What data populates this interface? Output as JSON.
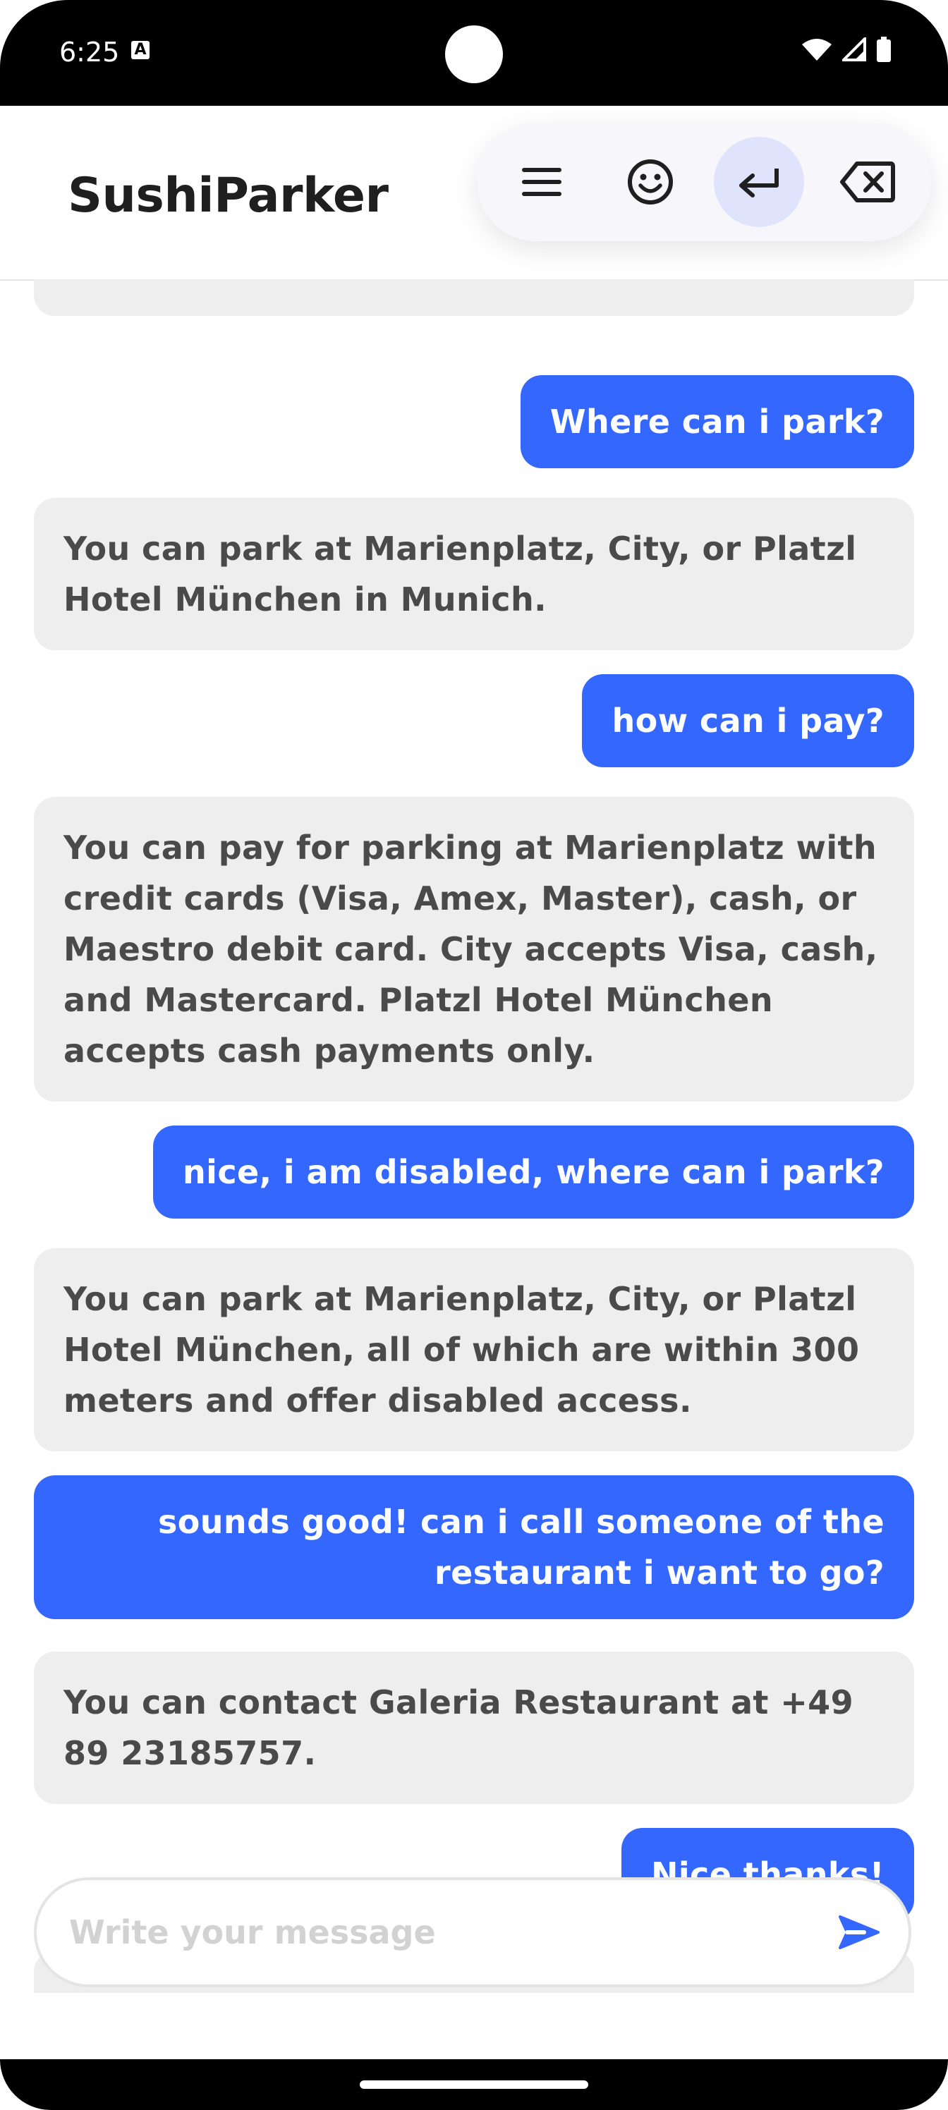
{
  "status_bar": {
    "time": "6:25",
    "notification_icon": "A",
    "icons": [
      "wifi-icon",
      "cellular-signal-icon",
      "battery-icon"
    ]
  },
  "app": {
    "title": "SushiParker"
  },
  "keyboard_toolbar": {
    "buttons": [
      "menu-icon",
      "emoji-icon",
      "enter-icon",
      "backspace-icon"
    ],
    "active": "enter-icon"
  },
  "colors": {
    "user_bubble": "#3467fe",
    "bot_bubble": "#eeeeee",
    "bot_text": "#4a4a4a",
    "active_key": "#dfe3fb"
  },
  "messages": [
    {
      "role": "user",
      "text": "Where can i park?"
    },
    {
      "role": "bot",
      "text": "You can park at Marienplatz, City, or Platzl Hotel München in Munich."
    },
    {
      "role": "user",
      "text": "how can i pay?"
    },
    {
      "role": "bot",
      "text": "You can pay for parking at Marienplatz with credit cards (Visa, Amex, Master), cash, or Maestro debit card. City accepts Visa, cash, and Mastercard. Platzl Hotel München accepts cash payments only."
    },
    {
      "role": "user",
      "text": "nice, i am disabled, where can i park?"
    },
    {
      "role": "bot",
      "text": "You can park at Marienplatz, City, or Platzl Hotel München, all of which are within 300 meters and offer disabled access."
    },
    {
      "role": "user",
      "text": "sounds good! can i call someone of the restaurant i want to go?"
    },
    {
      "role": "bot",
      "text": "You can contact Galeria Restaurant at +49 89 23185757."
    },
    {
      "role": "user",
      "text": "Nice thanks!"
    }
  ],
  "composer": {
    "placeholder": "Write your message",
    "value": ""
  }
}
